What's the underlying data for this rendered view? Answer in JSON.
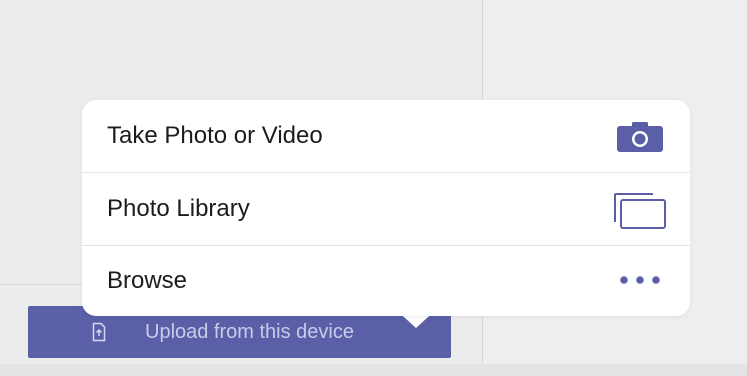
{
  "menu": {
    "items": [
      {
        "label": "Take Photo or Video",
        "icon": "camera-icon"
      },
      {
        "label": "Photo Library",
        "icon": "photo-library-icon"
      },
      {
        "label": "Browse",
        "icon": "more-icon"
      }
    ]
  },
  "upload": {
    "label": "Upload from this device",
    "icon": "file-upload-icon"
  },
  "colors": {
    "accent": "#5b5fa8",
    "upload_text": "#c9cbe8",
    "menu_bg": "#ffffff",
    "background": "#ececee"
  }
}
